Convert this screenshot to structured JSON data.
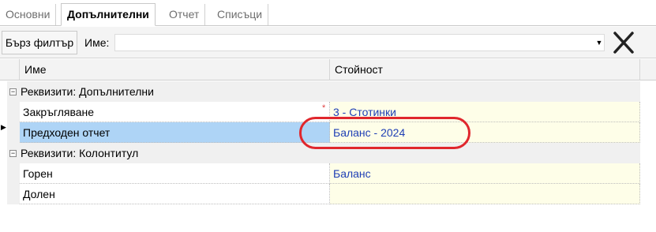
{
  "tabs": [
    {
      "label": "Основни"
    },
    {
      "label": "Допълнителни"
    },
    {
      "label": "Отчет"
    },
    {
      "label": "Списъци"
    }
  ],
  "filterbar": {
    "quick_filter_label": "Бърз филтър",
    "name_label": "Име:",
    "name_value": ""
  },
  "grid": {
    "headers": {
      "name": "Име",
      "value": "Стойност"
    },
    "groups": [
      {
        "label": "Реквизити: Допълнителни",
        "rows": [
          {
            "name": "Закръгляване",
            "value": "3 - Стотинки",
            "required": "*"
          },
          {
            "name": "Предходен отчет",
            "value": "Баланс - 2024",
            "selected": true
          }
        ]
      },
      {
        "label": "Реквизити: Колонтитул",
        "rows": [
          {
            "name": "Горен",
            "value": "Баланс"
          },
          {
            "name": "Долен",
            "value": ""
          }
        ]
      }
    ]
  },
  "colors": {
    "highlight_ellipse": "#e0272d",
    "selected_row": "#aed4f6",
    "value_text": "#1f3fb5"
  }
}
